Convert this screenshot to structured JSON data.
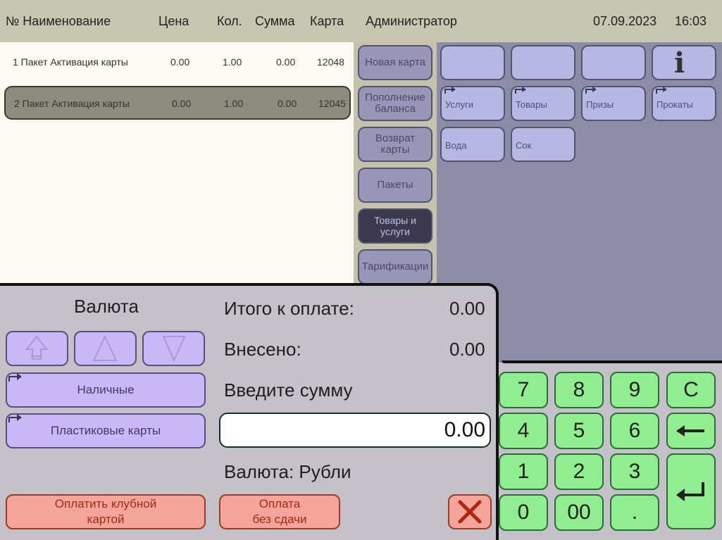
{
  "header": {
    "col_no_name": "№ Наименование",
    "col_price": "Цена",
    "col_qty": "Кол.",
    "col_sum": "Сумма",
    "col_card": "Карта",
    "user": "Администратор",
    "date": "07.09.2023",
    "time": "16:03"
  },
  "order_rows": [
    {
      "name": "1 Пакет Активация карты",
      "price": "0.00",
      "qty": "1.00",
      "sum": "0.00",
      "card": "12048"
    },
    {
      "name": "2 Пакет Активация карты",
      "price": "0.00",
      "qty": "1.00",
      "sum": "0.00",
      "card": "12045"
    }
  ],
  "categories": [
    "Новая карта",
    "Пополнение баланса",
    "Возврат карты",
    "Пакеты",
    "Товары и услуги",
    "Тарификации"
  ],
  "category_lines": {
    "topup_1": "Пополнение",
    "topup_2": "баланса",
    "return_1": "Возврат",
    "return_2": "карты",
    "goods_1": "Товары и",
    "goods_2": "услуги"
  },
  "grid_items": {
    "row2": [
      "Услуги",
      "Товары",
      "Призы",
      "Прокаты"
    ],
    "row3": [
      "Вода",
      "Сок"
    ],
    "info_icon": "i"
  },
  "payment": {
    "currency_title": "Валюта",
    "total_label": "Итого к оплате:",
    "total_value": "0.00",
    "paid_label": "Внесено:",
    "paid_value": "0.00",
    "enter_label": "Введите сумму",
    "amount_value": "0.00",
    "currency_line": "Валюта: Рубли",
    "cash_button": "Наличные",
    "card_button": "Пластиковые карты",
    "club_card_line1": "Оплатить клубной",
    "club_card_line2": "картой",
    "no_change_line1": "Оплата",
    "no_change_line2": "без сдачи"
  },
  "keypad": [
    "7",
    "8",
    "9",
    "C",
    "4",
    "5",
    "6",
    "1",
    "2",
    "3",
    "0",
    "00",
    "."
  ],
  "colors": {
    "header_bg": "#c7c6b1",
    "list_bg": "#fbfbf4",
    "grid_bg": "#8d8ca6",
    "item_button": "#b8b6e2",
    "panel_bg": "#c4c2c8",
    "purple_button": "#c9b8f7",
    "red_button": "#f5a49a",
    "key_green": "#90ee90"
  }
}
